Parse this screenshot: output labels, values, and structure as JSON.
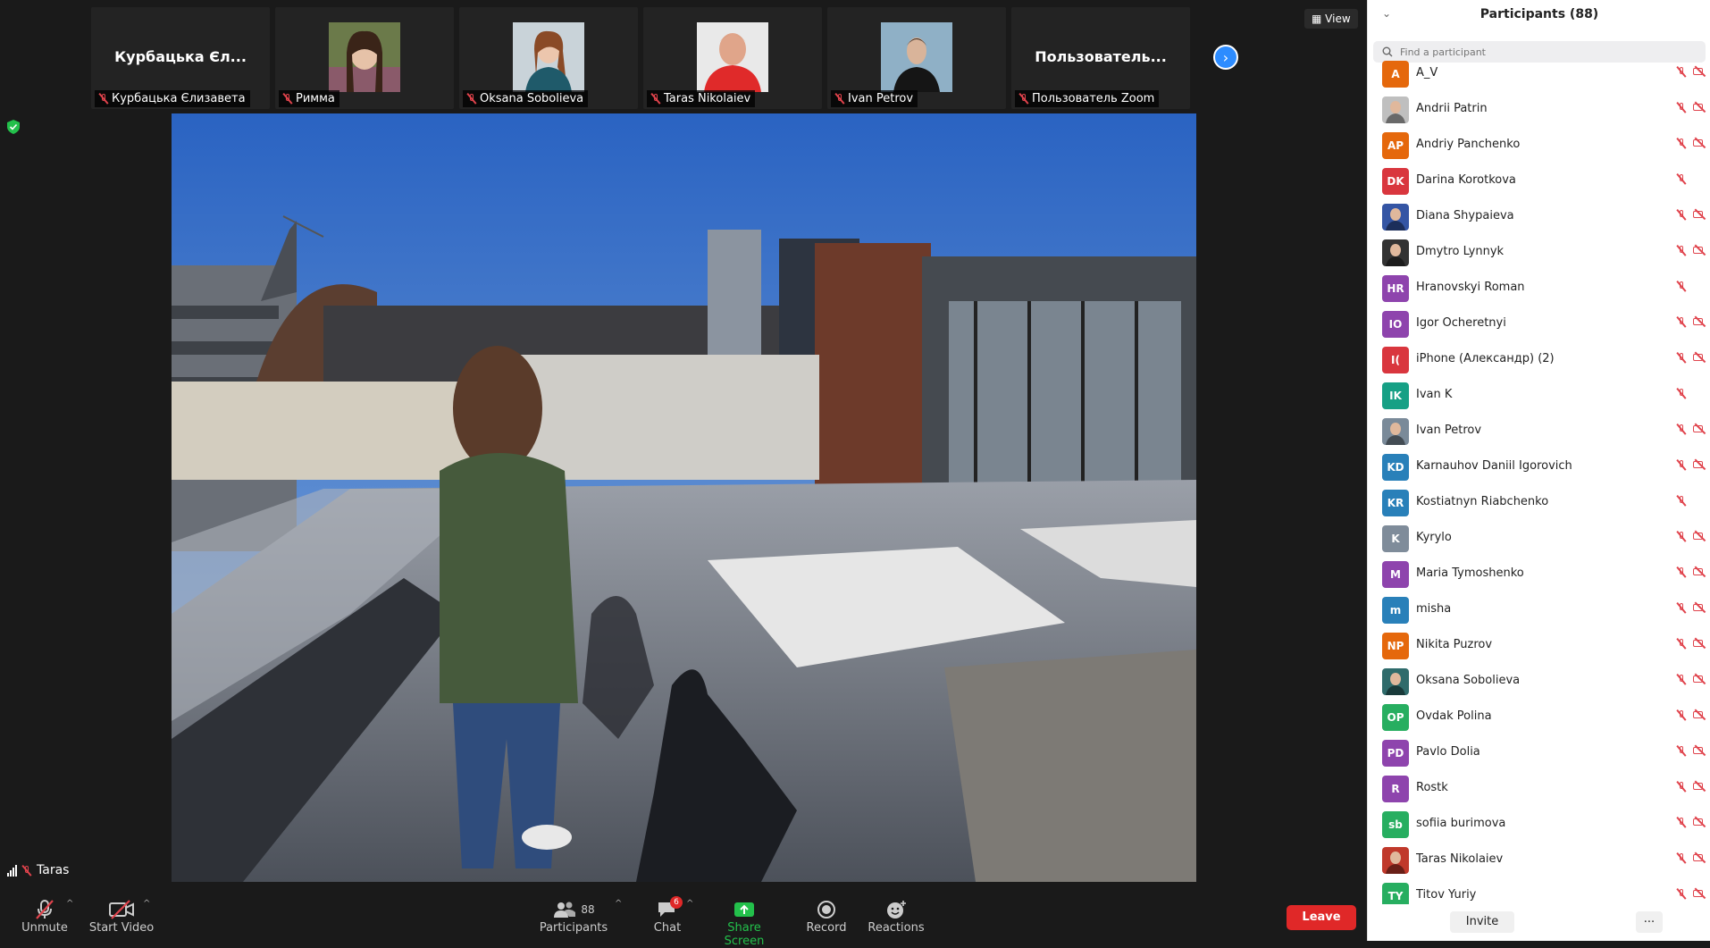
{
  "gallery": [
    {
      "big_name": "Курбацька Єл...",
      "label": "Курбацька Єлизавета"
    },
    {
      "label": "Римма",
      "photo": "photo-rimma"
    },
    {
      "label": "Oksana Sobolieva",
      "photo": "photo-oksana"
    },
    {
      "label": "Taras Nikolaiev",
      "photo": "photo-taras"
    },
    {
      "label": "Ivan Petrov",
      "photo": "photo-ivan"
    },
    {
      "big_name": "Пользователь...",
      "label": "Пользователь Zoom"
    }
  ],
  "view_label": "View",
  "active_speaker": "Taras",
  "toolbar": {
    "unmute": "Unmute",
    "start_video": "Start Video",
    "participants_count": "88",
    "participants": "Participants",
    "chat": "Chat",
    "chat_badge": "6",
    "share_screen": "Share Screen",
    "record": "Record",
    "reactions": "Reactions",
    "leave": "Leave"
  },
  "panel": {
    "title": "Participants (88)",
    "search_placeholder": "Find a participant",
    "invite": "Invite",
    "more": "...",
    "participants": [
      {
        "initials": "A",
        "name": "A_V",
        "color": "#e5680c",
        "video_off": true
      },
      {
        "initials": "",
        "name": "Andrii Patrin",
        "color": "#bfbfbf",
        "photo": true,
        "video_off": true
      },
      {
        "initials": "AP",
        "name": "Andriy Panchenko",
        "color": "#e5680c",
        "video_off": true
      },
      {
        "initials": "DK",
        "name": "Darina Korotkova",
        "color": "#d9363e",
        "video_off": false
      },
      {
        "initials": "",
        "name": "Diana Shypaieva",
        "color": "#3455a4",
        "photo": true,
        "video_off": true
      },
      {
        "initials": "",
        "name": "Dmytro Lynnyk",
        "color": "#333",
        "photo": true,
        "video_off": true
      },
      {
        "initials": "HR",
        "name": "Hranovskyi Roman",
        "color": "#8e44ad",
        "video_off": false
      },
      {
        "initials": "IO",
        "name": "Igor Ocheretnyi",
        "color": "#8e44ad",
        "video_off": true
      },
      {
        "initials": "I(",
        "name": "iPhone (Александр) (2)",
        "color": "#d9363e",
        "video_off": true
      },
      {
        "initials": "IK",
        "name": "Ivan K",
        "color": "#16a085",
        "video_off": false
      },
      {
        "initials": "",
        "name": "Ivan Petrov",
        "color": "#7a8a99",
        "photo": true,
        "video_off": true
      },
      {
        "initials": "KD",
        "name": "Karnauhov Daniil Igorovich",
        "color": "#2980b9",
        "video_off": true
      },
      {
        "initials": "KR",
        "name": "Kostiatnyn Riabchenko",
        "color": "#2980b9",
        "video_off": false
      },
      {
        "initials": "K",
        "name": "Kyrylo",
        "color": "#7f8c9a",
        "video_off": true
      },
      {
        "initials": "M",
        "name": "Maria Tymoshenko",
        "color": "#8e44ad",
        "video_off": true
      },
      {
        "initials": "m",
        "name": "misha",
        "color": "#2980b9",
        "video_off": true
      },
      {
        "initials": "NP",
        "name": "Nikita Puzrov",
        "color": "#e5680c",
        "video_off": true
      },
      {
        "initials": "",
        "name": "Oksana Sobolieva",
        "color": "#2f6b6b",
        "photo": true,
        "video_off": true
      },
      {
        "initials": "OP",
        "name": "Ovdak Polina",
        "color": "#27ae60",
        "video_off": true
      },
      {
        "initials": "PD",
        "name": "Pavlo Dolia",
        "color": "#8e44ad",
        "video_off": true
      },
      {
        "initials": "R",
        "name": "Rostk",
        "color": "#8e44ad",
        "video_off": true
      },
      {
        "initials": "sb",
        "name": "sofiia burimova",
        "color": "#27ae60",
        "video_off": true
      },
      {
        "initials": "",
        "name": "Taras Nikolaiev",
        "color": "#c0392b",
        "photo": true,
        "video_off": true
      },
      {
        "initials": "TY",
        "name": "Titov Yuriy",
        "color": "#27ae60",
        "video_off": true
      }
    ]
  }
}
